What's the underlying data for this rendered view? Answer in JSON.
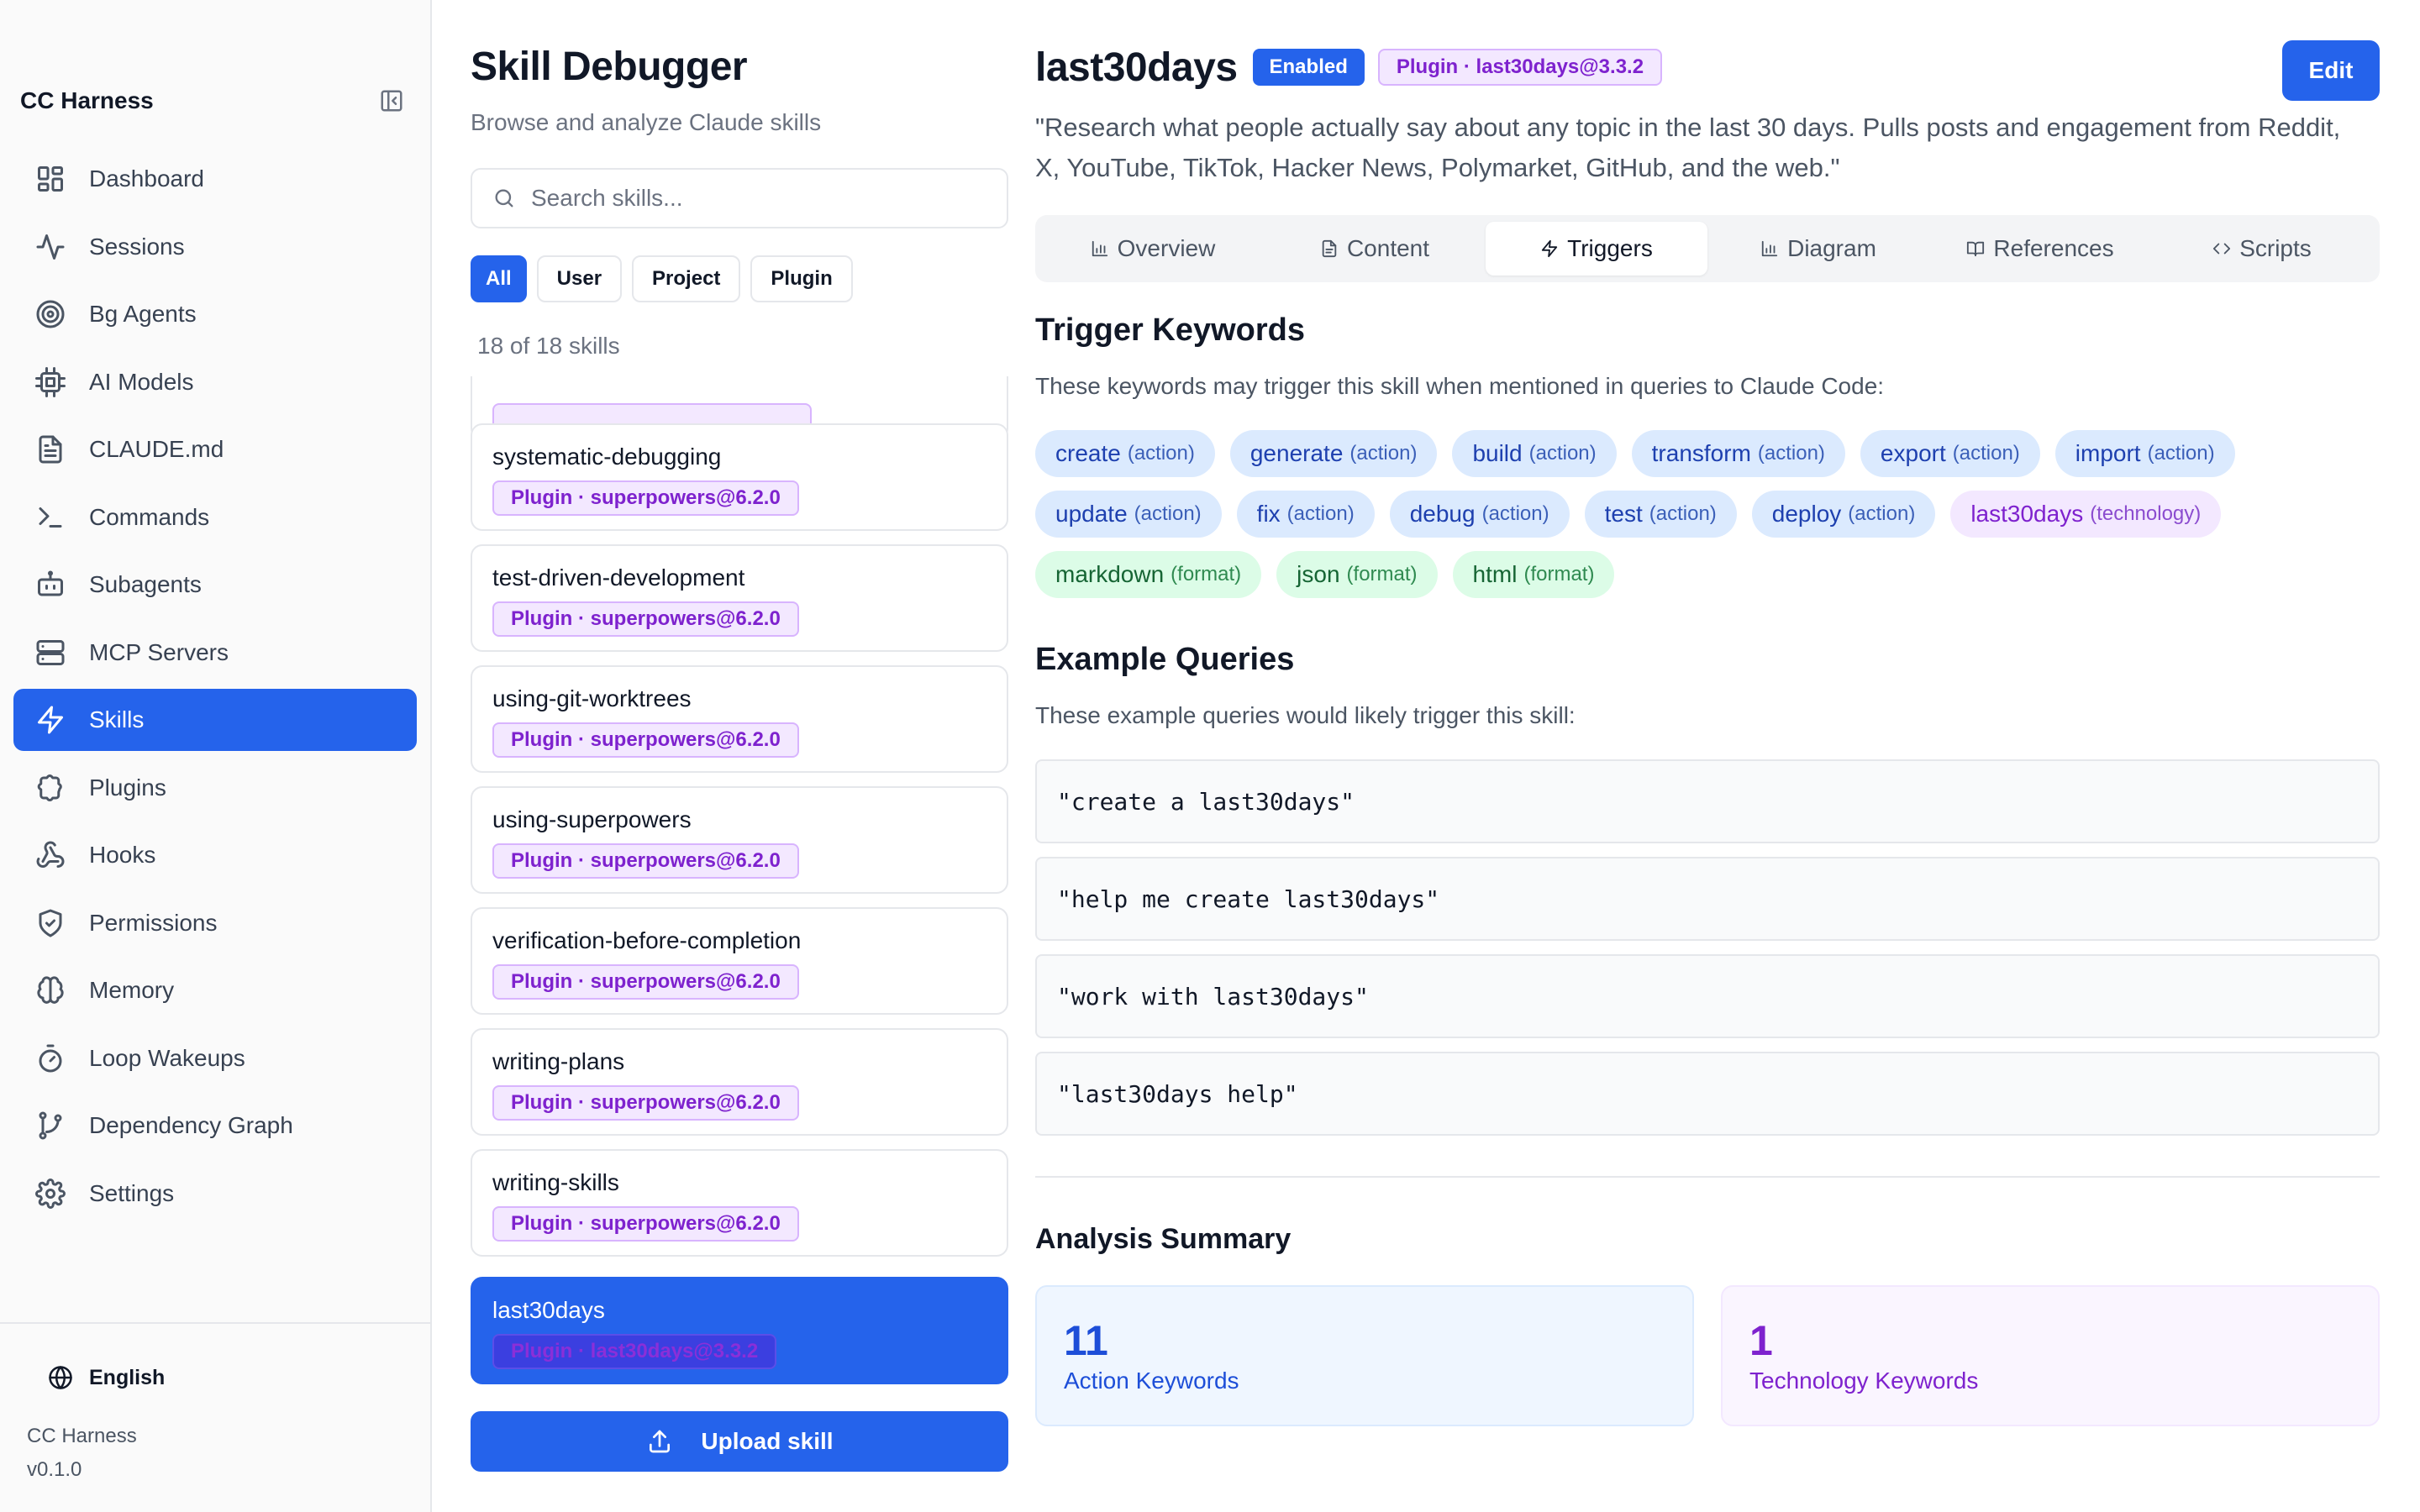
{
  "sidebar": {
    "brand": "CC Harness",
    "items": [
      {
        "label": "Dashboard",
        "icon": "dashboard-icon"
      },
      {
        "label": "Sessions",
        "icon": "activity-icon"
      },
      {
        "label": "Bg Agents",
        "icon": "target-icon"
      },
      {
        "label": "AI Models",
        "icon": "cpu-icon"
      },
      {
        "label": "CLAUDE.md",
        "icon": "file-text-icon"
      },
      {
        "label": "Commands",
        "icon": "terminal-icon"
      },
      {
        "label": "Subagents",
        "icon": "bot-icon"
      },
      {
        "label": "MCP Servers",
        "icon": "server-icon"
      },
      {
        "label": "Skills",
        "icon": "zap-icon",
        "active": true
      },
      {
        "label": "Plugins",
        "icon": "puzzle-icon"
      },
      {
        "label": "Hooks",
        "icon": "webhook-icon"
      },
      {
        "label": "Permissions",
        "icon": "shield-icon"
      },
      {
        "label": "Memory",
        "icon": "brain-icon"
      },
      {
        "label": "Loop Wakeups",
        "icon": "timer-icon"
      },
      {
        "label": "Dependency Graph",
        "icon": "git-branch-icon"
      },
      {
        "label": "Settings",
        "icon": "gear-icon"
      }
    ],
    "language": "English",
    "app_name": "CC Harness",
    "version": "v0.1.0"
  },
  "list": {
    "title": "Skill Debugger",
    "subtitle": "Browse and analyze Claude skills",
    "search_placeholder": "Search skills...",
    "filters": [
      "All",
      "User",
      "Project",
      "Plugin"
    ],
    "active_filter": "All",
    "count": "18 of 18 skills",
    "skills": [
      {
        "name": "",
        "tag": ""
      },
      {
        "name": "systematic-debugging",
        "tag": "Plugin · superpowers@6.2.0"
      },
      {
        "name": "test-driven-development",
        "tag": "Plugin · superpowers@6.2.0"
      },
      {
        "name": "using-git-worktrees",
        "tag": "Plugin · superpowers@6.2.0"
      },
      {
        "name": "using-superpowers",
        "tag": "Plugin · superpowers@6.2.0"
      },
      {
        "name": "verification-before-completion",
        "tag": "Plugin · superpowers@6.2.0"
      },
      {
        "name": "writing-plans",
        "tag": "Plugin · superpowers@6.2.0"
      },
      {
        "name": "writing-skills",
        "tag": "Plugin · superpowers@6.2.0"
      },
      {
        "name": "last30days",
        "tag": "Plugin · last30days@3.3.2",
        "active": true
      }
    ],
    "upload_label": "Upload skill"
  },
  "detail": {
    "title": "last30days",
    "status": "Enabled",
    "source": "Plugin · last30days@3.3.2",
    "edit_label": "Edit",
    "description": "\"Research what people actually say about any topic in the last 30 days. Pulls posts and engagement from Reddit, X, YouTube, TikTok, Hacker News, Polymarket, GitHub, and the web.\"",
    "tabs": [
      {
        "label": "Overview",
        "icon": "bar-chart-icon"
      },
      {
        "label": "Content",
        "icon": "file-icon"
      },
      {
        "label": "Triggers",
        "icon": "zap-icon",
        "active": true
      },
      {
        "label": "Diagram",
        "icon": "bar-chart-icon"
      },
      {
        "label": "References",
        "icon": "book-open-icon"
      },
      {
        "label": "Scripts",
        "icon": "code-icon"
      }
    ],
    "trigger_heading": "Trigger Keywords",
    "trigger_sub": "These keywords may trigger this skill when mentioned in queries to Claude Code:",
    "keywords": [
      {
        "word": "create",
        "type": "(action)",
        "kind": "action"
      },
      {
        "word": "generate",
        "type": "(action)",
        "kind": "action"
      },
      {
        "word": "build",
        "type": "(action)",
        "kind": "action"
      },
      {
        "word": "transform",
        "type": "(action)",
        "kind": "action"
      },
      {
        "word": "export",
        "type": "(action)",
        "kind": "action"
      },
      {
        "word": "import",
        "type": "(action)",
        "kind": "action"
      },
      {
        "word": "update",
        "type": "(action)",
        "kind": "action"
      },
      {
        "word": "fix",
        "type": "(action)",
        "kind": "action"
      },
      {
        "word": "debug",
        "type": "(action)",
        "kind": "action"
      },
      {
        "word": "test",
        "type": "(action)",
        "kind": "action"
      },
      {
        "word": "deploy",
        "type": "(action)",
        "kind": "action"
      },
      {
        "word": "last30days",
        "type": "(technology)",
        "kind": "technology"
      },
      {
        "word": "markdown",
        "type": "(format)",
        "kind": "format"
      },
      {
        "word": "json",
        "type": "(format)",
        "kind": "format"
      },
      {
        "word": "html",
        "type": "(format)",
        "kind": "format"
      }
    ],
    "examples_heading": "Example Queries",
    "examples_sub": "These example queries would likely trigger this skill:",
    "examples": [
      "\"create a last30days\"",
      "\"help me create last30days\"",
      "\"work with last30days\"",
      "\"last30days help\""
    ],
    "summary_heading": "Analysis Summary",
    "summary": {
      "action_count": "11",
      "action_label": "Action Keywords",
      "tech_count": "1",
      "tech_label": "Technology Keywords"
    }
  },
  "colors": {
    "accent": "#2563eb",
    "plugin_purple": "#7e22ce",
    "format_green": "#166534"
  }
}
